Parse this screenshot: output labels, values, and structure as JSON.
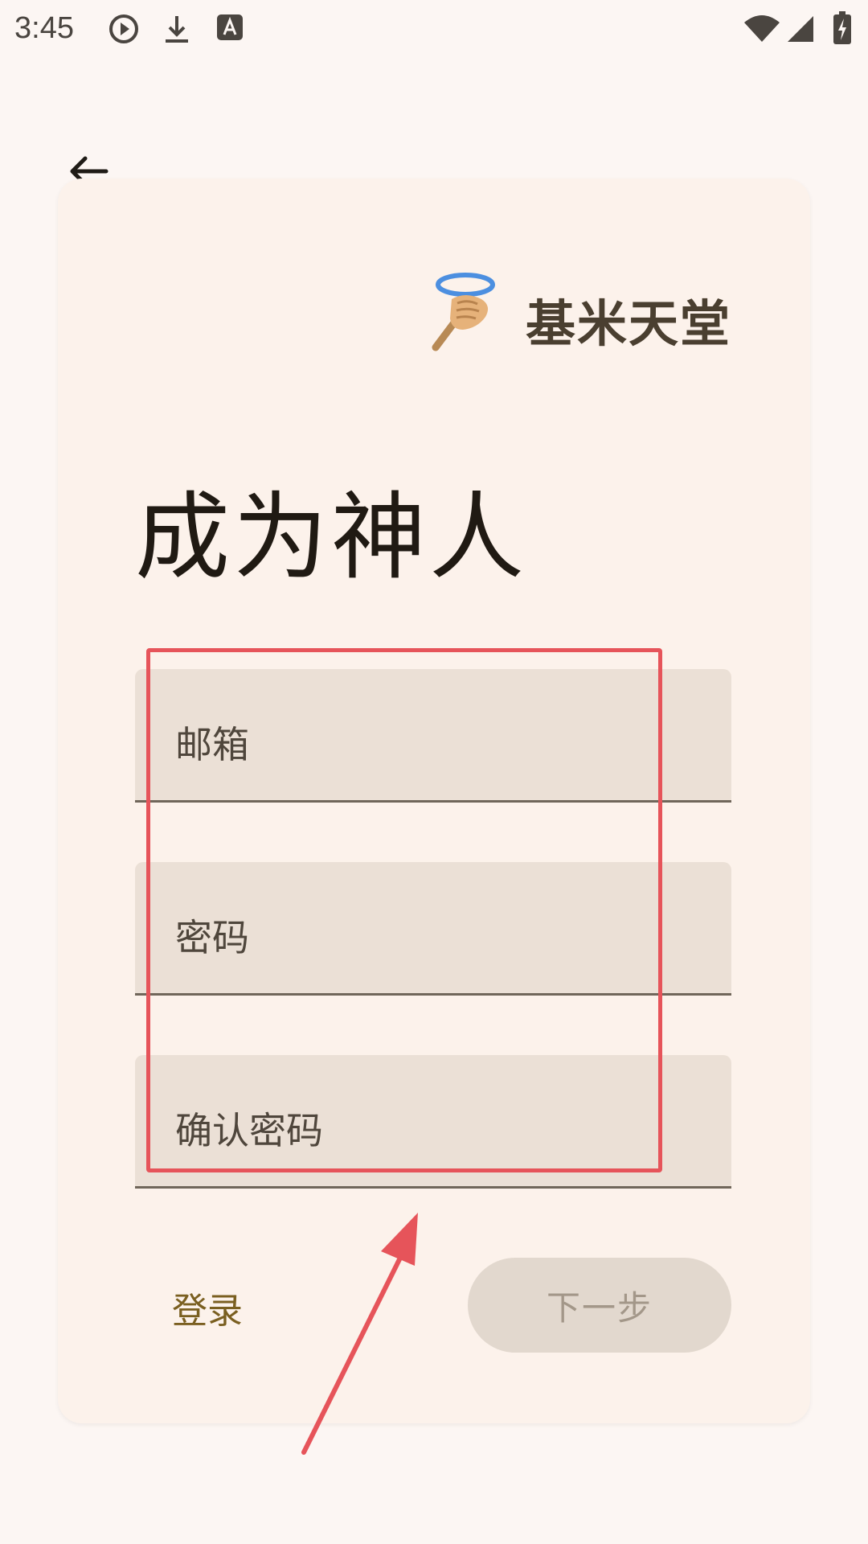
{
  "status_bar": {
    "time": "3:45",
    "left_icons": [
      "play-circle-icon",
      "download-icon",
      "text-a-icon"
    ],
    "right_icons": [
      "wifi-icon",
      "signal-icon",
      "battery-charging-icon"
    ]
  },
  "app_bar": {
    "back_icon": "arrow-left-icon"
  },
  "brand": {
    "logo_icon": "halo-hand-logo-icon",
    "name": "基米天堂"
  },
  "headline": "成为神人",
  "form": {
    "email_label": "邮箱",
    "password_label": "密码",
    "confirm_label": "确认密码"
  },
  "actions": {
    "login_label": "登录",
    "next_label": "下一步"
  },
  "colors": {
    "background": "#fcf6f3",
    "card": "#fcf2eb",
    "field_fill": "#ebe0d6",
    "link": "#7a5f20",
    "disabled_button": "#e2d8ce",
    "annotation": "#e6545a"
  }
}
